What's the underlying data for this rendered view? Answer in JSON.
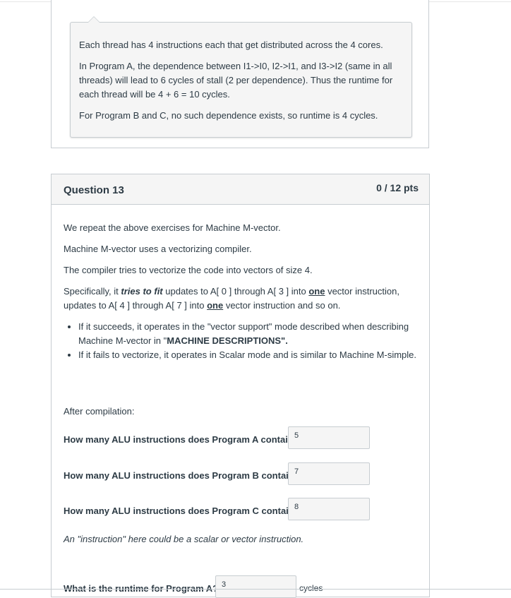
{
  "prev_comment": {
    "p1": "Each thread has 4 instructions each that get distributed across the 4 cores.",
    "p2": "In Program A, the dependence between I1->I0, I2->I1, and I3->I2 (same in all threads) will lead to 6 cycles of stall (2 per dependence). Thus the runtime for each thread will be 4 + 6 = 10 cycles.",
    "p3": "For Program B and C, no such dependence exists, so runtime is 4 cycles."
  },
  "question": {
    "title": "Question 13",
    "points": "0 / 12 pts",
    "p1": "We repeat the above exercises for Machine M-vector.",
    "p2": "Machine M-vector uses a vectorizing compiler.",
    "p3": "The compiler tries to vectorize the code into vectors of size 4.",
    "p4_a": "Specifically, it ",
    "p4_b": "tries to fit",
    "p4_c": " updates to A[ 0 ] through A[ 3 ] into ",
    "p4_d": "one",
    "p4_e": " vector instruction, updates to A[ 4 ] through A[ 7 ] into ",
    "p4_f": "one",
    "p4_g": " vector instruction and so on.",
    "bullet1_a": "If it succeeds, it operates in the \"vector support\" mode described when describing Machine M-vector in \"",
    "bullet1_b": "MACHINE DESCRIPTIONS\".",
    "bullet2": "If it fails to vectorize, it operates in Scalar mode and is similar to Machine M-simple.",
    "after": "After compilation:",
    "qa1_label": "How many ALU instructions does Program A contain?",
    "qa1_value": "5",
    "qa2_label": "How many ALU instructions does Program B contain?",
    "qa2_value": "7",
    "qa3_label": "How many ALU instructions does Program C contain?",
    "qa3_value": "8",
    "note": "An \"instruction\" here could be a scalar or vector instruction.",
    "qa4_label": "What is the runtime for Program A?",
    "qa4_value": "3",
    "qa4_unit": "cycles"
  }
}
